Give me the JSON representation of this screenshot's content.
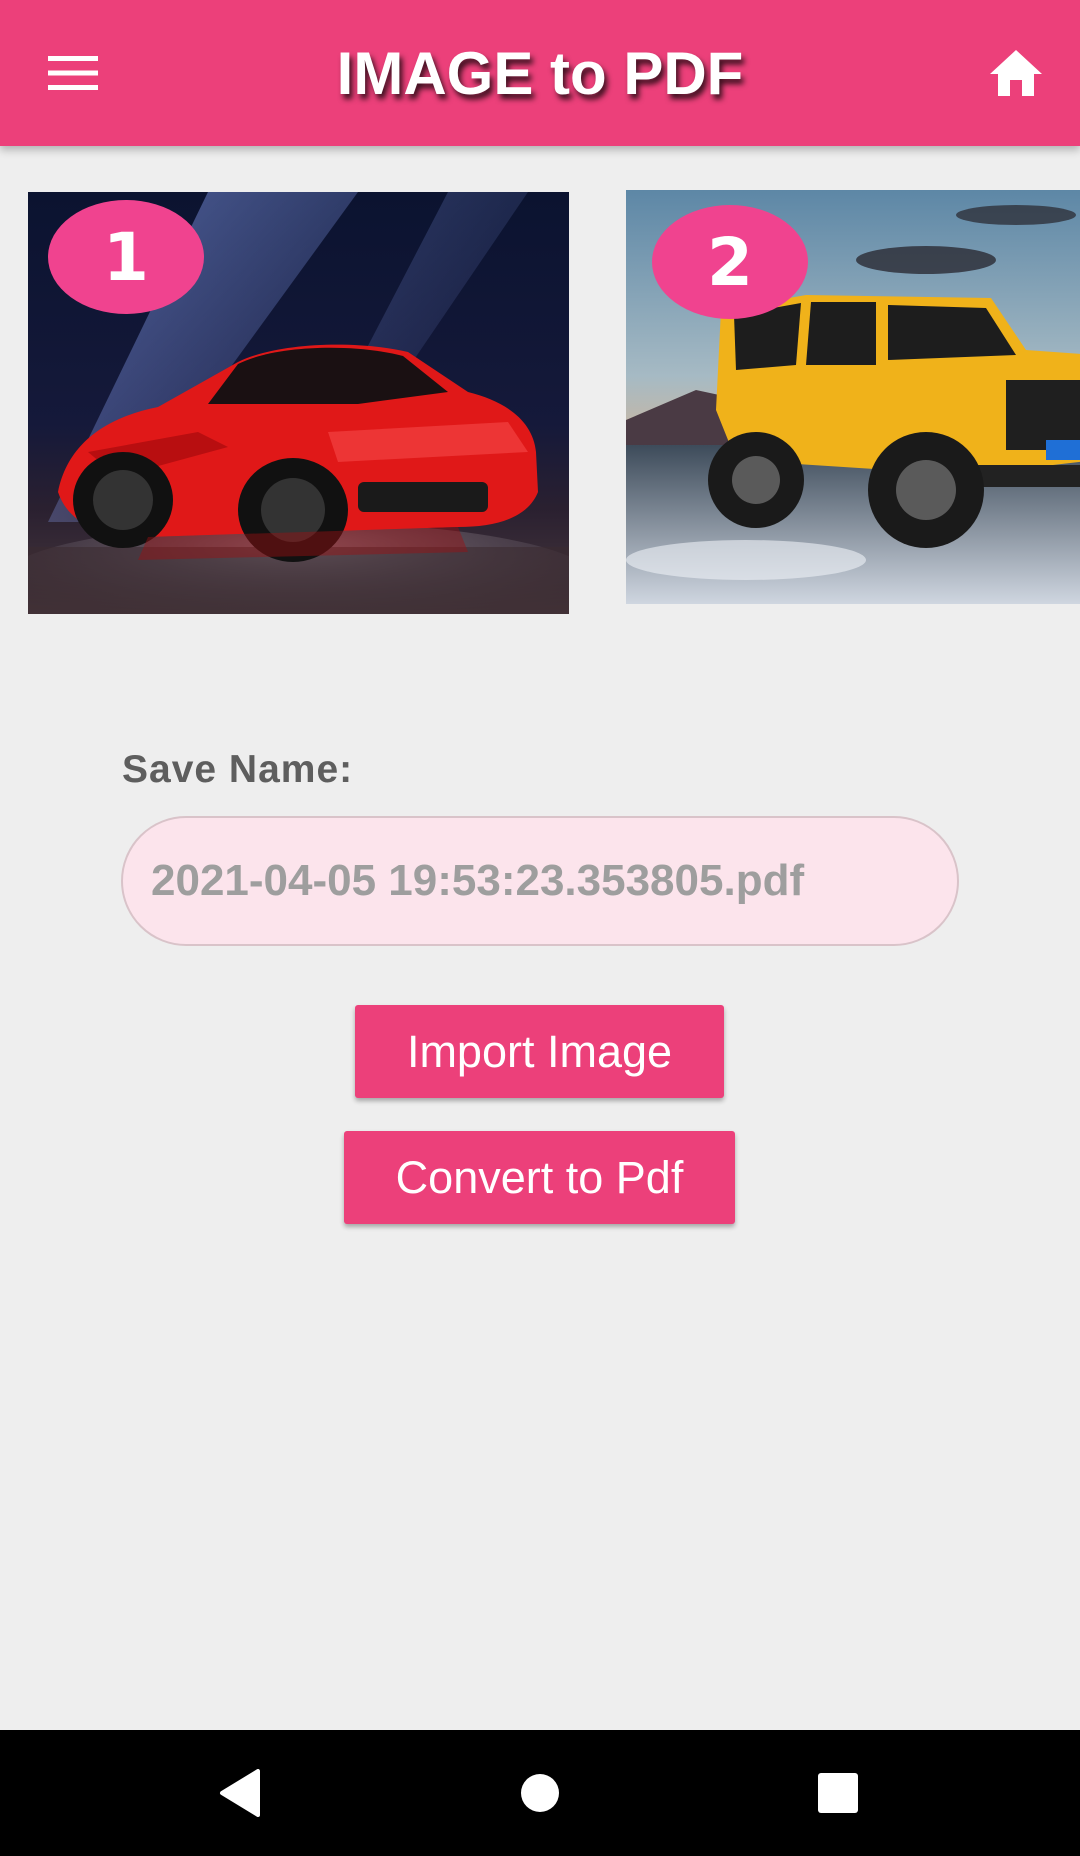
{
  "app_bar": {
    "title": "IMAGE to PDF",
    "background_color": "#ec407a",
    "menu_icon": "hamburger-menu-icon",
    "home_icon": "home-icon"
  },
  "images": [
    {
      "number": "1",
      "subject": "red sports car"
    },
    {
      "number": "2",
      "subject": "yellow off-road vehicle"
    }
  ],
  "save_name": {
    "label": "Save Name:",
    "placeholder": "2021-04-05 19:53:23.353805.pdf"
  },
  "buttons": {
    "import_label": "Import Image",
    "convert_label": "Convert to Pdf"
  },
  "system_nav": {
    "back_icon": "back-triangle-icon",
    "home_icon": "home-circle-icon",
    "recents_icon": "recents-square-icon"
  },
  "colors": {
    "accent": "#ec407a",
    "badge": "#f0438f",
    "input_fill": "#fce4ec",
    "page_background": "#eeeeee"
  }
}
